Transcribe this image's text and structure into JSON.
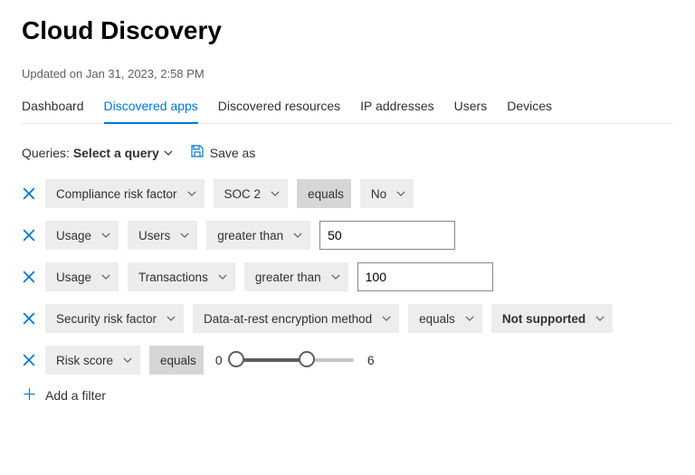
{
  "header": {
    "title": "Cloud Discovery",
    "updated": "Updated on Jan 31, 2023, 2:58 PM"
  },
  "tabs": [
    {
      "label": "Dashboard",
      "active": false
    },
    {
      "label": "Discovered apps",
      "active": true
    },
    {
      "label": "Discovered resources",
      "active": false
    },
    {
      "label": "IP addresses",
      "active": false
    },
    {
      "label": "Users",
      "active": false
    },
    {
      "label": "Devices",
      "active": false
    }
  ],
  "queries": {
    "label": "Queries:",
    "select_label": "Select a query",
    "save_as_label": "Save as"
  },
  "filters": [
    {
      "category": "Compliance risk factor",
      "sub": "SOC 2",
      "op": "equals",
      "op_dark": true,
      "value_pill": "No"
    },
    {
      "category": "Usage",
      "sub": "Users",
      "op": "greater than",
      "op_dark": false,
      "value_input": "50"
    },
    {
      "category": "Usage",
      "sub": "Transactions",
      "op": "greater than",
      "op_dark": false,
      "value_input": "100"
    },
    {
      "category": "Security risk factor",
      "sub": "Data-at-rest encryption method",
      "op": "equals",
      "op_dark": false,
      "value_pill": "Not supported",
      "value_bold": true
    }
  ],
  "slider_filter": {
    "category": "Risk score",
    "op": "equals",
    "op_dark": true,
    "min": 0,
    "max": 6,
    "scale_max": 10
  },
  "add_filter_label": "Add a filter"
}
